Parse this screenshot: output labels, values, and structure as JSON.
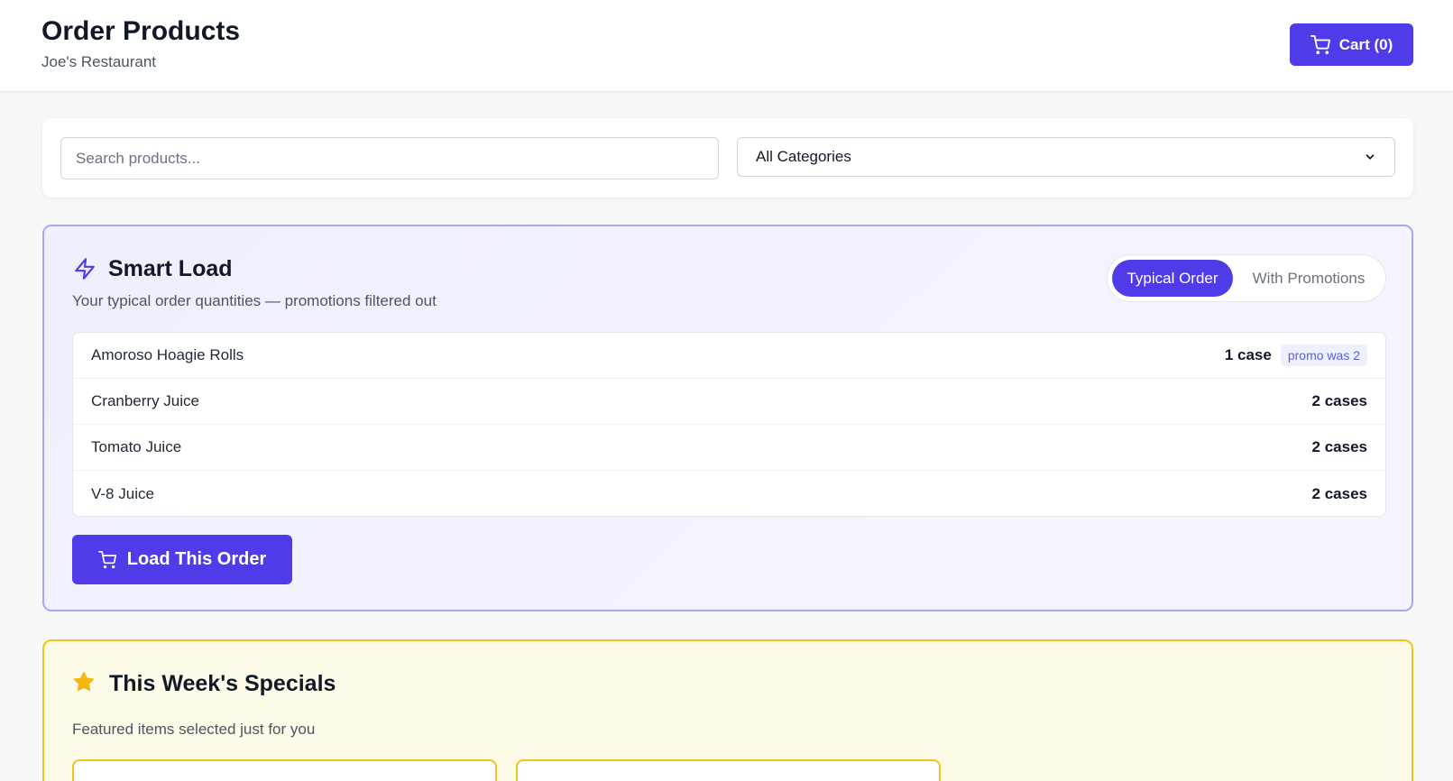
{
  "header": {
    "title": "Order Products",
    "subtitle": "Joe's Restaurant",
    "cart_label": "Cart (0)"
  },
  "search": {
    "placeholder": "Search products...",
    "category_selected": "All Categories"
  },
  "smart_load": {
    "title": "Smart Load",
    "subtitle": "Your typical order quantities — promotions filtered out",
    "toggle_options": [
      "Typical Order",
      "With Promotions"
    ],
    "active_toggle": "Typical Order",
    "items": [
      {
        "name": "Amoroso Hoagie Rolls",
        "quantity": "1 case",
        "badge": "promo was 2"
      },
      {
        "name": "Cranberry Juice",
        "quantity": "2 cases",
        "badge": ""
      },
      {
        "name": "Tomato Juice",
        "quantity": "2 cases",
        "badge": ""
      },
      {
        "name": "V-8 Juice",
        "quantity": "2 cases",
        "badge": ""
      }
    ],
    "load_button_label": "Load This Order"
  },
  "specials": {
    "title": "This Week's Specials",
    "subtitle": "Featured items selected just for you"
  },
  "colors": {
    "accent": "#4f3ce8",
    "smart_border": "#a5a8f2",
    "specials_border": "#f2c419",
    "specials_bg": "#fffbe9"
  },
  "icons": {
    "cart": "cart-icon",
    "smart_load": "lightning-icon",
    "specials": "star-icon",
    "select": "chevron-down-icon"
  }
}
